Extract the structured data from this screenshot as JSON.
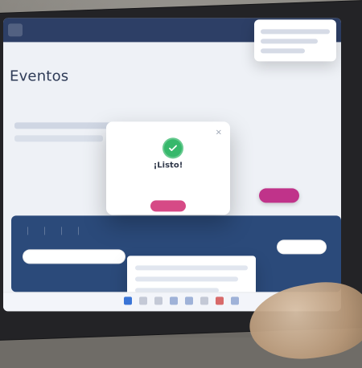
{
  "app": {
    "breadcrumb": "",
    "title": "Eventos",
    "subtitle": "",
    "top_menu": [
      "",
      ""
    ]
  },
  "filters": {
    "label": ""
  },
  "primary_action": {
    "label": ""
  },
  "table": {
    "headers": [
      "",
      "",
      "",
      "",
      ""
    ],
    "search_placeholder": "",
    "footer_note": ""
  },
  "modal": {
    "title": "¡Listo!",
    "message": "",
    "ok_label": "",
    "close_icon": "close-icon",
    "status_color": "#36b86b",
    "icon": "check-circle-icon"
  },
  "taskbar": {
    "icons": [
      "windows-icon",
      "search-icon",
      "task-view-icon",
      "folder-icon",
      "browser-icon",
      "mail-icon",
      "settings-icon",
      "app-icon"
    ]
  },
  "colors": {
    "navy": "#2d3f66",
    "table_blue": "#2b4a7a",
    "accent_pink": "#c0338a"
  }
}
